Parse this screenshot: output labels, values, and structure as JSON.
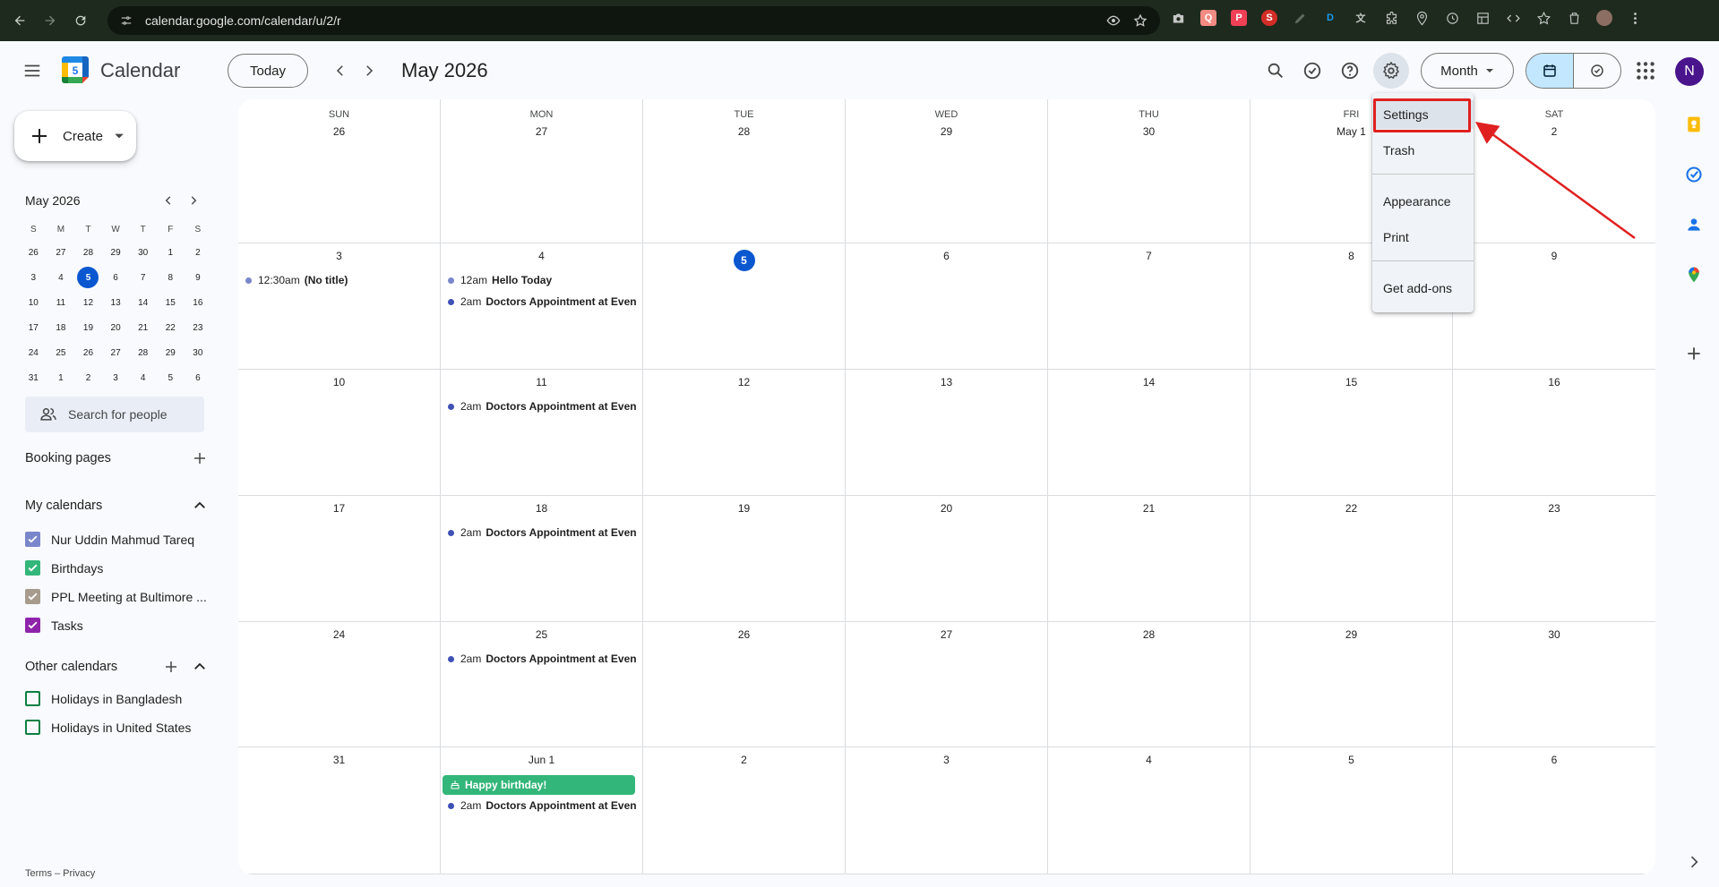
{
  "browser": {
    "url": "calendar.google.com/calendar/u/2/r"
  },
  "header": {
    "app_title": "Calendar",
    "logo_day": "5",
    "today_label": "Today",
    "month_title": "May 2026",
    "view_label": "Month",
    "avatar_initial": "N"
  },
  "sidebar": {
    "create_label": "Create",
    "mini_calendar": {
      "title": "May 2026",
      "days_of_week": [
        "S",
        "M",
        "T",
        "W",
        "T",
        "F",
        "S"
      ],
      "weeks": [
        [
          "26",
          "27",
          "28",
          "29",
          "30",
          "1",
          "2"
        ],
        [
          "3",
          "4",
          "5",
          "6",
          "7",
          "8",
          "9"
        ],
        [
          "10",
          "11",
          "12",
          "13",
          "14",
          "15",
          "16"
        ],
        [
          "17",
          "18",
          "19",
          "20",
          "21",
          "22",
          "23"
        ],
        [
          "24",
          "25",
          "26",
          "27",
          "28",
          "29",
          "30"
        ],
        [
          "31",
          "1",
          "2",
          "3",
          "4",
          "5",
          "6"
        ]
      ],
      "today": "5"
    },
    "search_people_placeholder": "Search for people",
    "booking_pages_label": "Booking pages",
    "my_calendars_label": "My calendars",
    "my_calendars": [
      {
        "name": "Nur Uddin Mahmud Tareq",
        "color": "#7986cb",
        "checked": true
      },
      {
        "name": "Birthdays",
        "color": "#33b679",
        "checked": true
      },
      {
        "name": "PPL Meeting at Bultimore ...",
        "color": "#a79b8e",
        "checked": true
      },
      {
        "name": "Tasks",
        "color": "#8e24aa",
        "checked": true
      }
    ],
    "other_calendars_label": "Other calendars",
    "other_calendars": [
      {
        "name": "Holidays in Bangladesh",
        "color": "#0b8043",
        "checked": false
      },
      {
        "name": "Holidays in United States",
        "color": "#0b8043",
        "checked": false
      }
    ],
    "footer": "Terms – Privacy"
  },
  "calendar": {
    "days_of_week": [
      "SUN",
      "MON",
      "TUE",
      "WED",
      "THU",
      "FRI",
      "SAT"
    ],
    "weeks": [
      {
        "dates": [
          "26",
          "27",
          "28",
          "29",
          "30",
          "May 1",
          "2"
        ]
      },
      {
        "dates": [
          "3",
          "4",
          "5",
          "6",
          "7",
          "8",
          "9"
        ]
      },
      {
        "dates": [
          "10",
          "11",
          "12",
          "13",
          "14",
          "15",
          "16"
        ]
      },
      {
        "dates": [
          "17",
          "18",
          "19",
          "20",
          "21",
          "22",
          "23"
        ]
      },
      {
        "dates": [
          "24",
          "25",
          "26",
          "27",
          "28",
          "29",
          "30"
        ]
      },
      {
        "dates": [
          "31",
          "Jun 1",
          "2",
          "3",
          "4",
          "5",
          "6"
        ]
      }
    ],
    "events": {
      "w1_sun": {
        "time": "12:30am",
        "title": "(No title)",
        "color": "#7986cb"
      },
      "w1_mon_1": {
        "time": "12am",
        "title": "Hello Today",
        "color": "#7986cb"
      },
      "w1_mon_2": {
        "time": "2am",
        "title": "Doctors Appointment at Evening",
        "color": "#3f51b5"
      },
      "w2_mon": {
        "time": "2am",
        "title": "Doctors Appointment at Evening",
        "color": "#3f51b5"
      },
      "w3_mon": {
        "time": "2am",
        "title": "Doctors Appointment at Evening",
        "color": "#3f51b5"
      },
      "w4_mon": {
        "time": "2am",
        "title": "Doctors Appointment at Evening",
        "color": "#3f51b5"
      },
      "w5_mon_bday": {
        "title": "Happy birthday!",
        "color": "#33b679"
      },
      "w5_mon": {
        "time": "2am",
        "title": "Doctors Appointment at Evening",
        "color": "#3f51b5"
      }
    }
  },
  "settings_menu": {
    "items": [
      "Settings",
      "Trash",
      "Appearance",
      "Print",
      "Get add-ons"
    ]
  }
}
